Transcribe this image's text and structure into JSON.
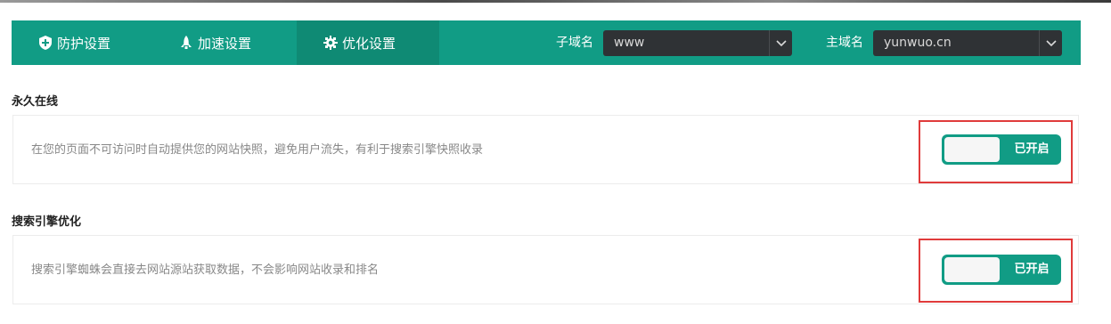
{
  "nav": {
    "tabs": [
      {
        "label": "防护设置",
        "icon": "shield-plus-icon"
      },
      {
        "label": "加速设置",
        "icon": "rocket-icon"
      },
      {
        "label": "优化设置",
        "icon": "gear-icon"
      }
    ],
    "active_tab": 2,
    "subdomain": {
      "label": "子域名",
      "value": "www"
    },
    "maindomain": {
      "label": "主域名",
      "value": "yunwuo.cn"
    }
  },
  "sections": [
    {
      "title": "永久在线",
      "description": "在您的页面不可访问时自动提供您的网站快照，避免用户流失，有利于搜索引擎快照收录",
      "toggle_label": "已开启",
      "enabled": true
    },
    {
      "title": "搜索引擎优化",
      "description": "搜索引擎蜘蛛会直接去网站源站获取数据，不会影响网站收录和排名",
      "toggle_label": "已开启",
      "enabled": true
    }
  ],
  "colors": {
    "accent": "#119c85",
    "active_tab": "#0f8a74",
    "select_bg": "#2f3235",
    "highlight": "#e03b3b"
  }
}
